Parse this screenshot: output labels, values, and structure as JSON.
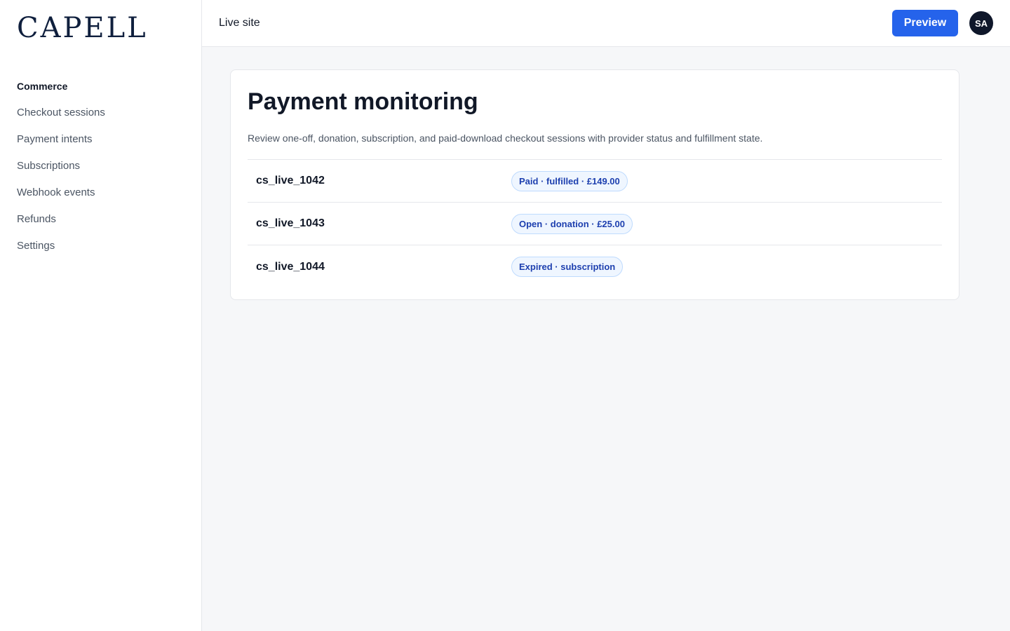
{
  "brand": {
    "logo": "CAPELL"
  },
  "sidebar": {
    "heading": "Commerce",
    "items": [
      {
        "label": "Checkout sessions"
      },
      {
        "label": "Payment intents"
      },
      {
        "label": "Subscriptions"
      },
      {
        "label": "Webhook events"
      },
      {
        "label": "Refunds"
      },
      {
        "label": "Settings"
      }
    ]
  },
  "topbar": {
    "title": "Live site",
    "preview_label": "Preview",
    "avatar_initials": "SA"
  },
  "main": {
    "title": "Payment monitoring",
    "description": "Review one-off, donation, subscription, and paid-download checkout sessions with provider status and fulfillment state.",
    "rows": [
      {
        "id": "cs_live_1042",
        "status": "Paid · fulfilled · £149.00"
      },
      {
        "id": "cs_live_1043",
        "status": "Open · donation · £25.00"
      },
      {
        "id": "cs_live_1044",
        "status": "Expired · subscription"
      }
    ]
  },
  "colors": {
    "accent": "#2563eb",
    "brand_text": "#0f1f3d",
    "badge_bg": "#eff6ff",
    "badge_text": "#1e40af",
    "avatar_bg": "#0f172a"
  }
}
